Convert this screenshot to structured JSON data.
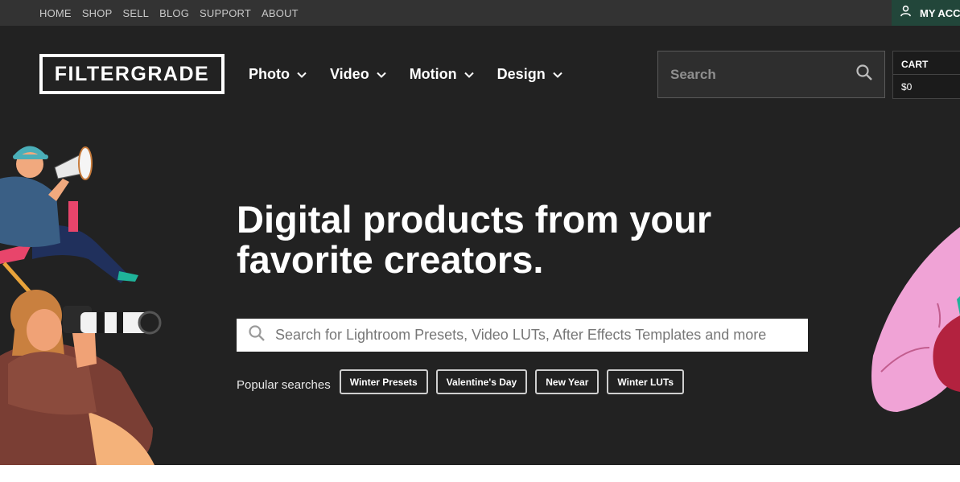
{
  "topbar": {
    "links": [
      "HOME",
      "SHOP",
      "SELL",
      "BLOG",
      "SUPPORT",
      "ABOUT"
    ],
    "account_label": "MY ACCOUNT",
    "account_icon": "user-icon"
  },
  "header": {
    "logo_text": "FILTERGRADE",
    "nav": [
      "Photo",
      "Video",
      "Motion",
      "Design"
    ],
    "search_placeholder": "Search",
    "cart_label": "CART",
    "cart_total": "$0"
  },
  "hero": {
    "headline": "Digital products from your favorite creators.",
    "search_placeholder": "Search for Lightroom Presets, Video LUTs, After Effects Templates and more",
    "popular_label": "Popular searches",
    "popular_chips": [
      "Winter Presets",
      "Valentine's Day",
      "New Year",
      "Winter LUTs"
    ]
  },
  "colors": {
    "topbar_bg": "#333333",
    "hero_bg": "#222222",
    "account_bg": "#22463a"
  }
}
